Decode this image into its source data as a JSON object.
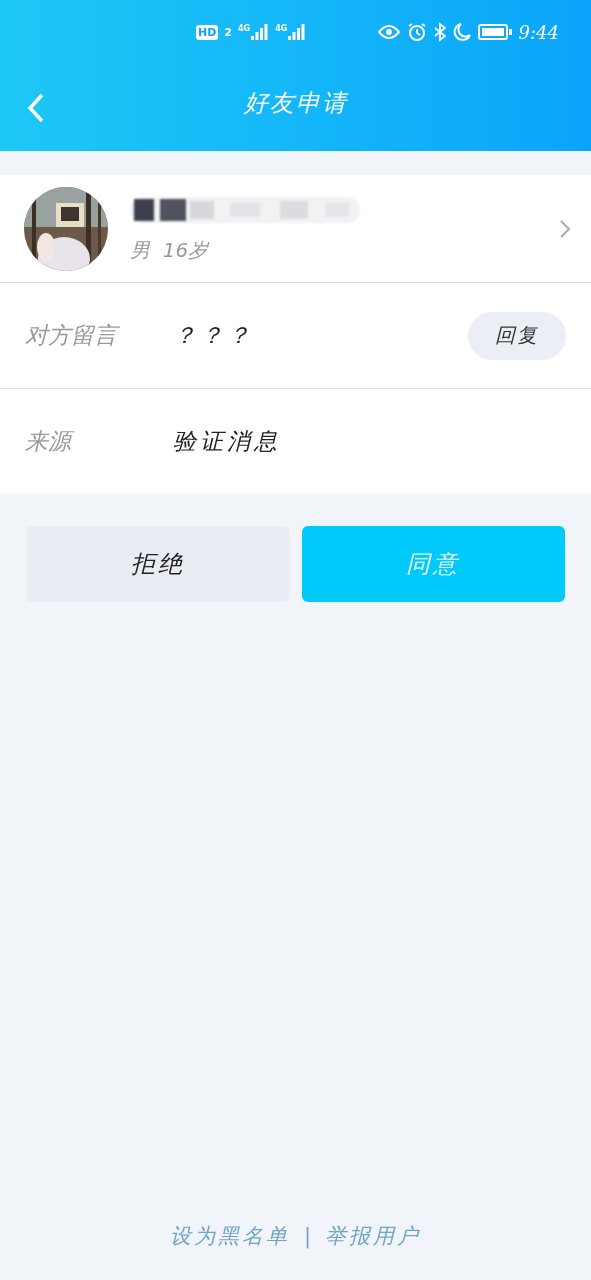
{
  "status_bar": {
    "hd_badge": "HD",
    "sim_number": "2",
    "signals": [
      {
        "label": "4G"
      },
      {
        "label": "4G"
      }
    ],
    "time": "9:44"
  },
  "header": {
    "title": "好友申请"
  },
  "profile": {
    "details": "男  16岁"
  },
  "fields": [
    {
      "kind": "message",
      "label": "对方留言",
      "value": "？？？",
      "action": "回复"
    },
    {
      "kind": "plain",
      "label": "来源",
      "value": "验证消息"
    }
  ],
  "buttons": [
    {
      "label": "拒绝",
      "primary": false
    },
    {
      "label": "同意",
      "primary": true
    }
  ],
  "footer": {
    "links": [
      "设为黑名单",
      "举报用户"
    ],
    "separator": "|"
  }
}
